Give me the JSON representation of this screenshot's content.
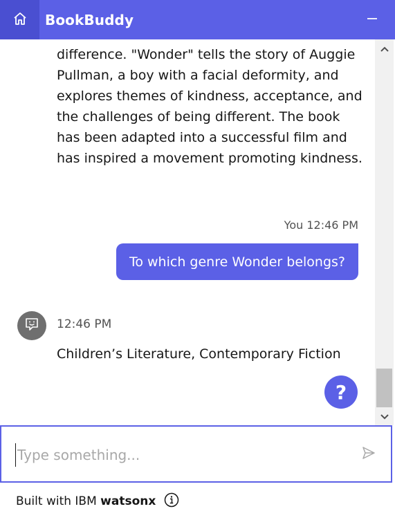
{
  "header": {
    "title": "BookBuddy",
    "home_icon": "home-icon",
    "minimize_icon": "minimize-icon",
    "color": "#5b60e6"
  },
  "messages": {
    "previous_bot_text": "difference. \"Wonder\" tells the story of Auggie Pullman, a boy with a facial deformity, and explores themes of kindness, acceptance, and the challenges of being different. The book has been adapted into a successful film and has inspired a movement promoting kindness.",
    "user_sender": "You",
    "user_time": "12:46 PM",
    "user_text": "To which genre Wonder belongs?",
    "bot_time": "12:46 PM",
    "bot_text": "Children’s Literature, Contemporary Fiction",
    "bot_avatar_icon": "bot-face-icon"
  },
  "help": {
    "label": "?"
  },
  "input": {
    "placeholder": "Type something...",
    "value": "",
    "send_icon": "send-icon"
  },
  "footer": {
    "prefix": "Built with IBM ",
    "brand": "watsonx",
    "info_icon": "info-icon"
  }
}
